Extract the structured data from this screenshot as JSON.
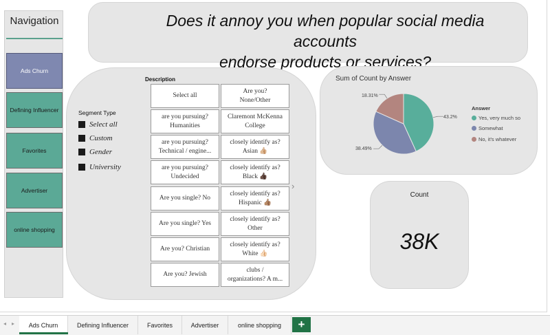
{
  "navigation": {
    "title": "Navigation",
    "items": [
      {
        "label": "Ads Churn"
      },
      {
        "label": "Defining Influencer"
      },
      {
        "label": "Favorites"
      },
      {
        "label": "Advertiser"
      },
      {
        "label": "online shopping"
      }
    ]
  },
  "title": {
    "line1": "Does it annoy you when popular social media accounts",
    "line2": "endorse products or services?"
  },
  "segment": {
    "title": "Segment Type",
    "options": [
      "Select all",
      "Custom",
      "Gender",
      "University"
    ]
  },
  "description": {
    "title": "Description",
    "tiles": [
      [
        "Select all"
      ],
      [
        "Are you?",
        "None/Other"
      ],
      [
        "are you pursuing?",
        "Humanities"
      ],
      [
        "Claremont McKenna",
        "College"
      ],
      [
        "are you pursuing?",
        "Technical / engine..."
      ],
      [
        "closely identify as?",
        "Asian 👍🏼"
      ],
      [
        "are you pursuing?",
        "Undecided"
      ],
      [
        "closely identify as?",
        "Black 👍🏿"
      ],
      [
        "Are you single? No"
      ],
      [
        "closely identify as?",
        "Hispanic 👍🏽"
      ],
      [
        "Are you single? Yes"
      ],
      [
        "closely identify as?",
        "Other"
      ],
      [
        "Are you? Christian"
      ],
      [
        "closely identify as?",
        "White 👍🏻"
      ],
      [
        "Are you? Jewish"
      ],
      [
        "clubs /",
        "organizations? A m..."
      ]
    ]
  },
  "pie": {
    "title": "Sum of Count by Answer",
    "legend_title": "Answer",
    "labels": [
      "43.2%",
      "38.49%",
      "18.31%"
    ]
  },
  "chart_data": {
    "type": "pie",
    "title": "Sum of Count by Answer",
    "legend_title": "Answer",
    "categories": [
      "Yes, very much so",
      "Somewhat",
      "No, it's whatever"
    ],
    "values": [
      43.2,
      38.49,
      18.31
    ],
    "colors": [
      "#58ae9b",
      "#7c86ad",
      "#b3857f"
    ],
    "legend_position": "right"
  },
  "card": {
    "label": "Count",
    "value": "38K"
  },
  "tabs": {
    "items": [
      "Ads Churn",
      "Defining Influencer",
      "Favorites",
      "Advertiser",
      "online shopping"
    ],
    "add": "+"
  }
}
